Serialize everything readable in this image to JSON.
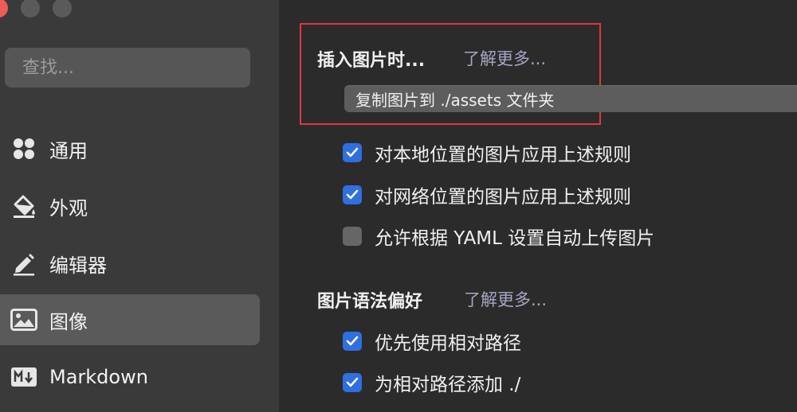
{
  "sidebar": {
    "search": {
      "placeholder": "查找..."
    },
    "items": [
      {
        "label": "通用",
        "icon": "grid-icon",
        "active": false
      },
      {
        "label": "外观",
        "icon": "paint-bucket-icon",
        "active": false
      },
      {
        "label": "编辑器",
        "icon": "pencil-icon",
        "active": false
      },
      {
        "label": "图像",
        "icon": "image-icon",
        "active": true
      },
      {
        "label": "Markdown",
        "icon": "markdown-icon",
        "active": false
      }
    ]
  },
  "main": {
    "insert_section": {
      "title": "插入图片时...",
      "learn_more": "了解更多...",
      "select_value": "复制图片到 ./assets 文件夹",
      "options": [
        {
          "label": "对本地位置的图片应用上述规则",
          "checked": true
        },
        {
          "label": "对网络位置的图片应用上述规则",
          "checked": true
        },
        {
          "label": "允许根据 YAML 设置自动上传图片",
          "checked": false
        }
      ]
    },
    "syntax_section": {
      "title": "图片语法偏好",
      "learn_more": "了解更多...",
      "options": [
        {
          "label": "优先使用相对路径",
          "checked": true
        },
        {
          "label": "为相对路径添加 ./",
          "checked": true
        }
      ]
    }
  },
  "colors": {
    "accent": "#2f6fe0",
    "highlight_border": "#e0383b",
    "sidebar_bg": "#3a3a3b",
    "main_bg": "#2b2b2b"
  }
}
